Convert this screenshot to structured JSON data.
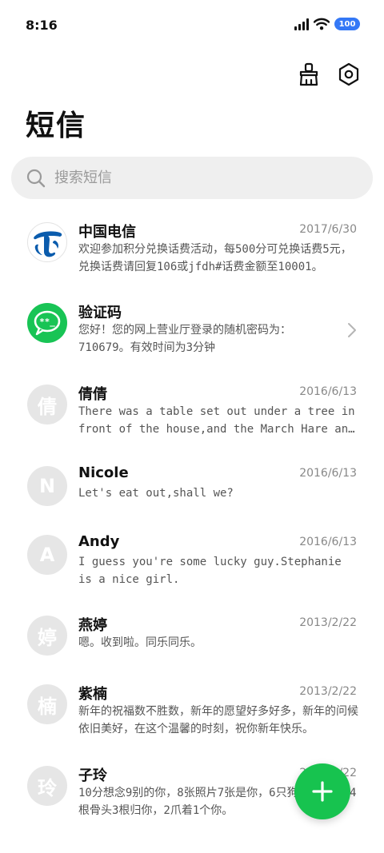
{
  "status_bar": {
    "time": "8:16",
    "battery": "100"
  },
  "header": {
    "title": "短信"
  },
  "toolbar": {
    "clean_icon": "broom-icon",
    "settings_icon": "hexagon-gear-icon"
  },
  "search": {
    "placeholder": "搜索短信",
    "value": ""
  },
  "messages": [
    {
      "name": "中国电信",
      "date": "2017/6/30",
      "preview": "欢迎参加积分兑换话费活动，每500分可兑换话费5元，兑换话费请回复106或jfdh#话费金额至10001。",
      "avatar": "telecom-logo"
    },
    {
      "name": "验证码",
      "date": "",
      "preview": "您好！您的网上营业厅登录的随机密码为：710679。有效时间为3分钟",
      "avatar": "sms-code-icon"
    },
    {
      "name": "倩倩",
      "date": "2016/6/13",
      "preview": "There was a table set out under a tree in front of the house,and the March Hare and the Hatter were having tea at it.",
      "avatar_text": "倩"
    },
    {
      "name": "Nicole",
      "date": "2016/6/13",
      "preview": "Let's eat out,shall we?",
      "avatar_text": "N"
    },
    {
      "name": "Andy",
      "date": "2016/6/13",
      "preview": "I guess you're some lucky guy.Stephanie is a nice girl.",
      "avatar_text": "A"
    },
    {
      "name": "燕婷",
      "date": "2013/2/22",
      "preview": "嗯。收到啦。同乐同乐。",
      "avatar_text": "婷"
    },
    {
      "name": "紫楠",
      "date": "2013/2/22",
      "preview": "新年的祝福数不胜数，新年的愿望好多好多，新年的问候依旧美好，在这个温馨的时刻，祝你新年快乐。",
      "avatar_text": "楠"
    },
    {
      "name": "子玲",
      "date": "2013/2/22",
      "preview": "10分想念9别的你，8张照片7张是你，6只狗5只像你，4根骨头3根归你，2爪着1个你。",
      "avatar_text": "玲"
    }
  ],
  "fab": {
    "label": "+",
    "icon": "plus-icon"
  },
  "colors": {
    "accent": "#17c34f",
    "battery": "#3478f6",
    "telecom_blue": "#0b5cad"
  }
}
